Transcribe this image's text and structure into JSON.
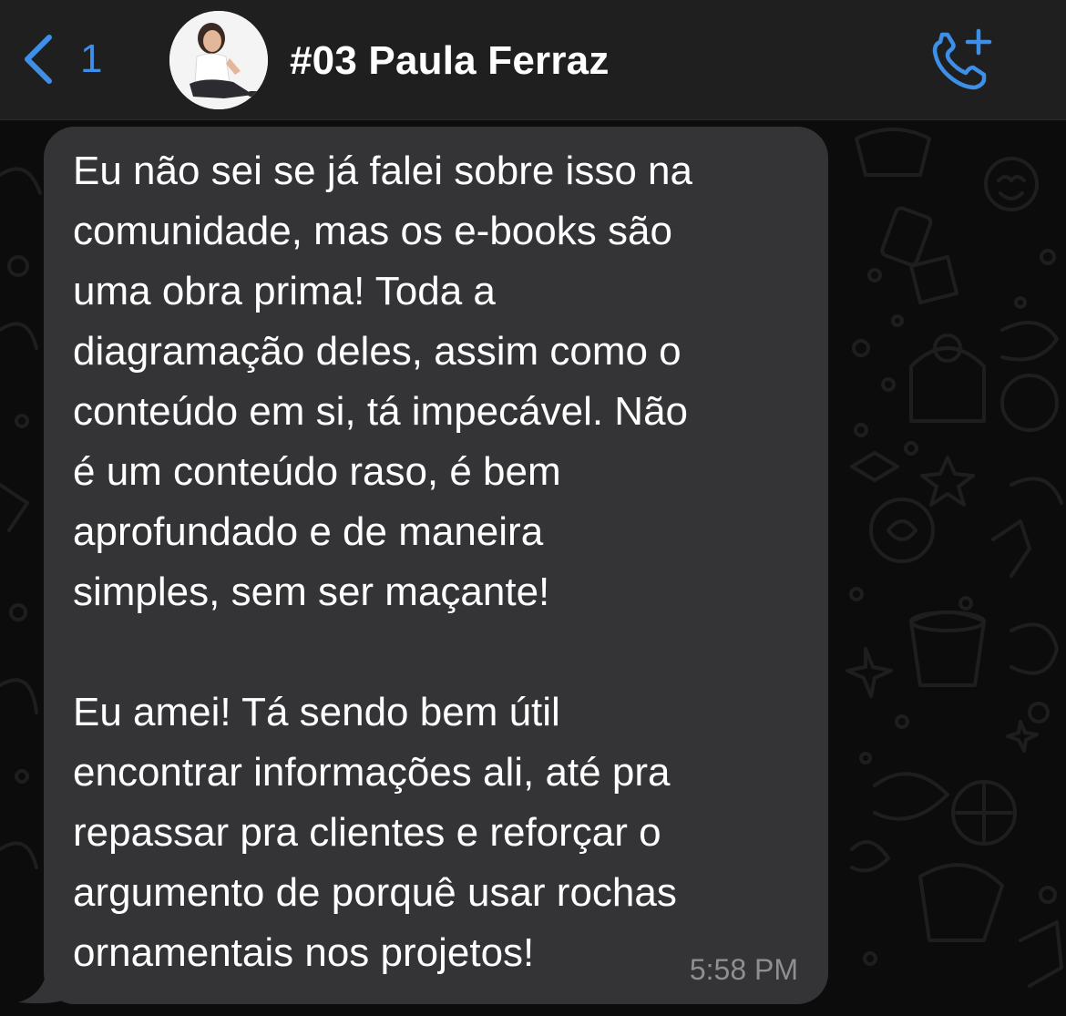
{
  "header": {
    "back_count": "1",
    "contact_name": "#03 Paula Ferraz",
    "icons": {
      "back": "chevron-left-icon",
      "avatar": "avatar",
      "call": "phone-add-icon"
    }
  },
  "message": {
    "lines": [
      "Eu não sei se já falei sobre isso na",
      "comunidade, mas os e-books são",
      "uma obra prima! Toda a",
      "diagramação deles, assim como o",
      "conteúdo em si, tá impecável. Não",
      "é um conteúdo raso, é bem",
      "aprofundado e de maneira",
      "simples, sem ser maçante!",
      "",
      "Eu amei! Tá sendo bem útil",
      "encontrar informações ali, até pra",
      "repassar pra clientes e reforçar o",
      "argumento de porquê usar rochas",
      "ornamentais nos projetos!"
    ],
    "time": "5:58 PM"
  },
  "colors": {
    "accent": "#3d8fe8",
    "header_bg": "#1f1f1f",
    "chat_bg": "#0c0c0c",
    "bubble_bg": "#343436",
    "text": "#ffffff",
    "timestamp": "#8e8e93"
  }
}
